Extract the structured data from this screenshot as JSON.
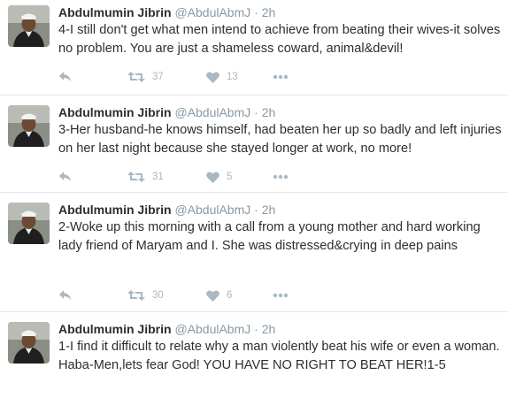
{
  "tweets": [
    {
      "author": "Abdulmumin Jibrin",
      "handle": "@AbdulAbmJ",
      "separator": "·",
      "time": "2h",
      "text": "4-I still don't get what men intend to achieve from beating their wives-it solves no problem. You are just a shameless coward, animal&devil!",
      "retweets": "37",
      "likes": "13"
    },
    {
      "author": "Abdulmumin Jibrin",
      "handle": "@AbdulAbmJ",
      "separator": "·",
      "time": "2h",
      "text": "3-Her husband-he knows himself, had beaten her up so badly and left injuries on her last night because she stayed longer at work, no more!",
      "retweets": "31",
      "likes": "5"
    },
    {
      "author": "Abdulmumin Jibrin",
      "handle": "@AbdulAbmJ",
      "separator": "·",
      "time": "2h",
      "text": "2-Woke up this morning with a call from a young mother and hard working lady friend of Maryam and I. She was distressed&crying in deep pains",
      "retweets": "30",
      "likes": "6"
    },
    {
      "author": "Abdulmumin Jibrin",
      "handle": "@AbdulAbmJ",
      "separator": "·",
      "time": "2h",
      "text": "1-I find it difficult to relate why a man violently beat his wife or even a woman. Haba-Men,lets fear God! YOU HAVE NO RIGHT TO BEAT HER!1-5"
    }
  ],
  "icons": {
    "reply": "reply-icon",
    "retweet": "retweet-icon",
    "like": "heart-icon",
    "more": "more-icon"
  },
  "colors": {
    "action_gray": "#aab8c2",
    "meta_gray": "#8899a6",
    "text": "#292f33",
    "divider": "#e1e8ed"
  }
}
